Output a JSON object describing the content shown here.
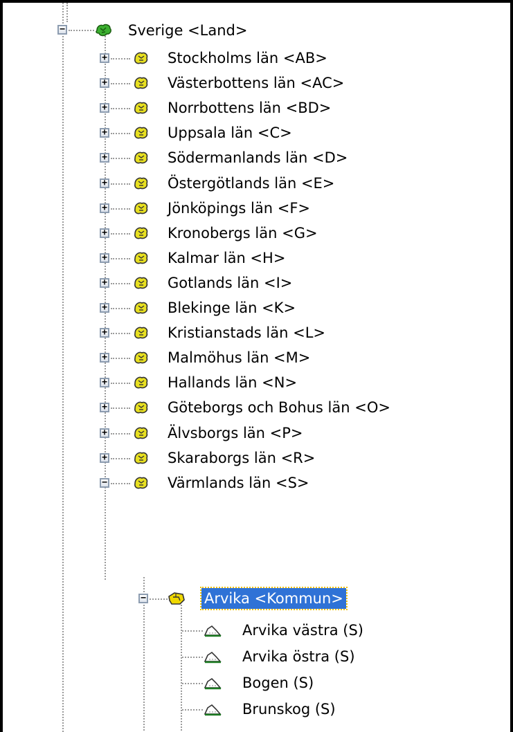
{
  "tree": {
    "root": {
      "label": "Sverige <Land>",
      "icon": "country-globe-icon",
      "expanded": true
    },
    "counties": [
      {
        "label": "Stockholms län <AB>",
        "expanded": false
      },
      {
        "label": "Västerbottens län <AC>",
        "expanded": false
      },
      {
        "label": "Norrbottens län <BD>",
        "expanded": false
      },
      {
        "label": "Uppsala län <C>",
        "expanded": false
      },
      {
        "label": "Södermanlands län <D>",
        "expanded": false
      },
      {
        "label": "Östergötlands län <E>",
        "expanded": false
      },
      {
        "label": "Jönköpings län <F>",
        "expanded": false
      },
      {
        "label": "Kronobergs län <G>",
        "expanded": false
      },
      {
        "label": "Kalmar län <H>",
        "expanded": false
      },
      {
        "label": "Gotlands län <I>",
        "expanded": false
      },
      {
        "label": "Blekinge län <K>",
        "expanded": false
      },
      {
        "label": "Kristianstads län <L>",
        "expanded": false
      },
      {
        "label": "Malmöhus län <M>",
        "expanded": false
      },
      {
        "label": "Hallands län <N>",
        "expanded": false
      },
      {
        "label": "Göteborgs och Bohus län <O>",
        "expanded": false
      },
      {
        "label": "Älvsborgs län <P>",
        "expanded": false
      },
      {
        "label": "Skaraborgs län <R>",
        "expanded": false
      },
      {
        "label": "Värmlands län <S>",
        "expanded": true
      }
    ],
    "municipality": {
      "label": "Arvika <Kommun>",
      "expanded": true,
      "selected": true
    },
    "parishes": [
      {
        "label": "Arvika västra (S)"
      },
      {
        "label": "Arvika östra (S)"
      },
      {
        "label": "Bogen (S)"
      },
      {
        "label": "Brunskog (S)"
      }
    ]
  },
  "colors": {
    "selection_bg": "#2f72d6",
    "selection_text": "#ffffff",
    "county_icon": "#e8e020",
    "country_icon": "#3cb030"
  }
}
